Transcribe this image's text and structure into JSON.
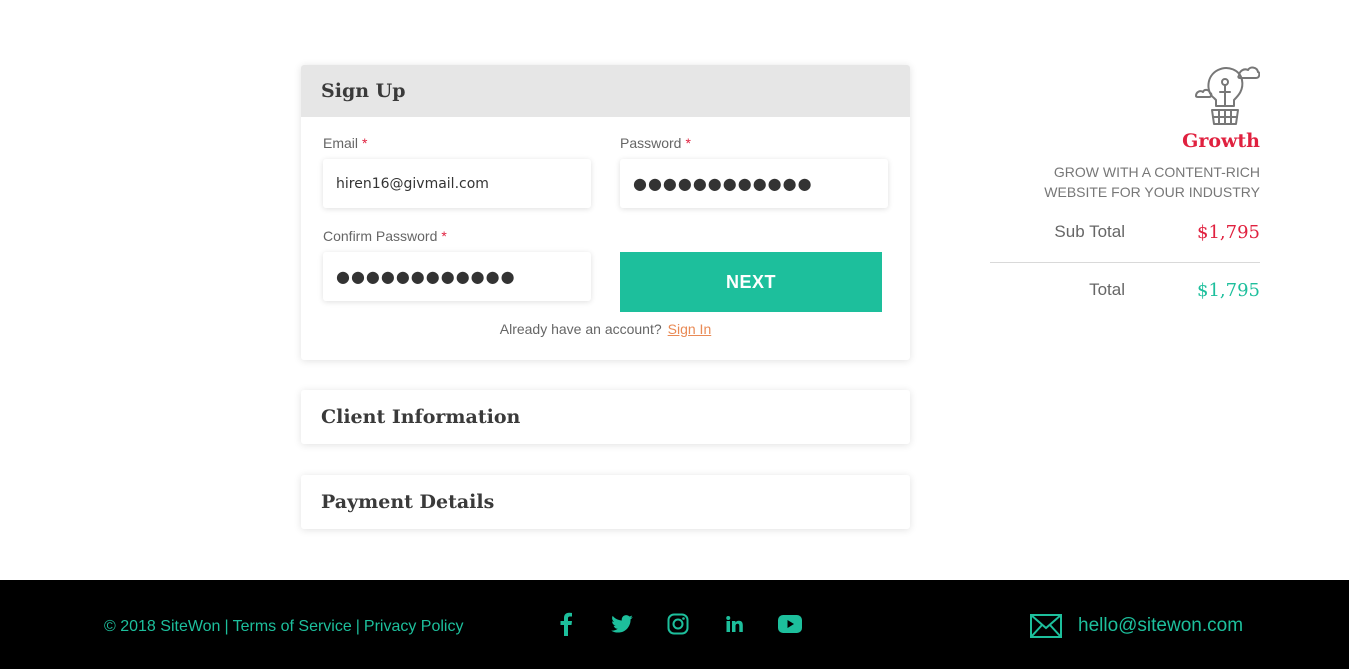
{
  "signup": {
    "title": "Sign Up",
    "email_label": "Email",
    "password_label": "Password",
    "confirm_label": "Confirm Password",
    "required_mark": "*",
    "email_value": "hiren16@givmail.com",
    "password_value": "●●●●●●●●●●●●",
    "confirm_value": "●●●●●●●●●●●●",
    "next_label": "NEXT",
    "already_text": "Already have an account?",
    "signin_label": "Sign In"
  },
  "sections": {
    "client_title": "Client Information",
    "payment_title": "Payment Details"
  },
  "plan": {
    "name": "Growth",
    "icon": "lightbulb-balloon-icon",
    "desc_line1": "GROW WITH A CONTENT-RICH",
    "desc_line2": "WEBSITE FOR YOUR INDUSTRY",
    "subtotal_label": "Sub Total",
    "subtotal_value": "$1,795",
    "total_label": "Total",
    "total_value": "$1,795"
  },
  "footer": {
    "copyright": "© 2018 SiteWon",
    "terms": "Terms of Service",
    "privacy": "Privacy Policy",
    "separator": "|",
    "email": "hello@sitewon.com",
    "socials": [
      "facebook-icon",
      "twitter-icon",
      "instagram-icon",
      "linkedin-icon",
      "youtube-icon"
    ]
  },
  "colors": {
    "accent": "#1dbf9c",
    "brand_red": "#e0213f",
    "link_orange": "#e98a55",
    "footer_bg": "#000000"
  }
}
